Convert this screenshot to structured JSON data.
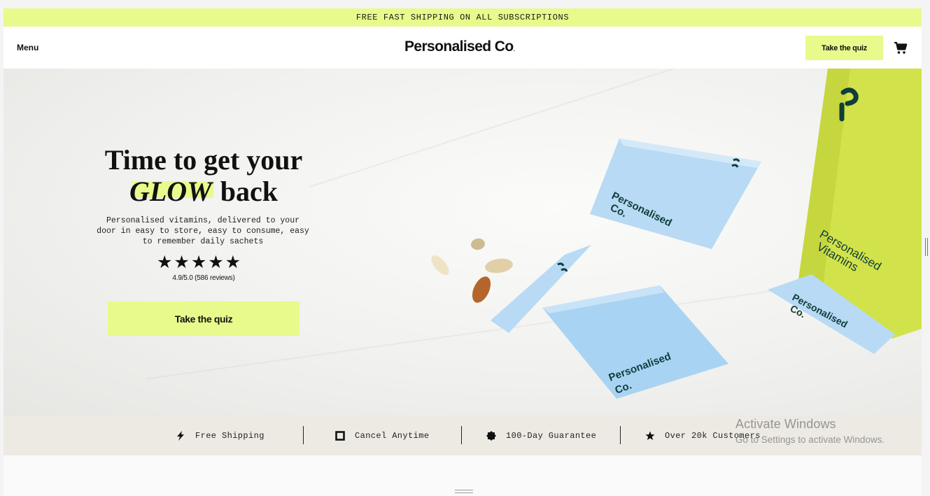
{
  "announcement": "FREE FAST SHIPPING ON ALL SUBSCRIPTIONS",
  "header": {
    "menu_label": "Menu",
    "logo": "Personalised Co",
    "logo_mark": ".",
    "quiz_label": "Take the quiz",
    "cart_icon": "cart-icon"
  },
  "hero": {
    "title_line1": "Time to get your",
    "title_highlight": "GLOW",
    "title_line2_rest": "back",
    "subtitle": "Personalised vitamins, delivered to your door in easy to store, easy to consume, easy to remember daily sachets",
    "stars": "★★★★★",
    "rating": "4.9/5.0 (586 reviews)",
    "cta_label": "Take the quiz",
    "product_text": {
      "sachet_brand_line1": "Personalised",
      "sachet_brand_line2": "Co.",
      "box_line1": "Personalised",
      "box_line2": "Vitamins"
    }
  },
  "trust_bar": [
    {
      "icon": "lightning-icon",
      "label": "Free Shipping"
    },
    {
      "icon": "square-icon",
      "label": "Cancel Anytime"
    },
    {
      "icon": "seal-icon",
      "label": "100-Day Guarantee"
    },
    {
      "icon": "star-icon",
      "label": "Over 20k Customers"
    }
  ],
  "watermark": {
    "title": "Activate Windows",
    "subtitle": "Go to Settings to activate Windows."
  },
  "colors": {
    "accent": "#e8fa8c",
    "sachet_blue": "#a9d3f2",
    "box_green": "#d2e24a",
    "brand_dark": "#0f3d3a",
    "trust_bg": "#eceae2"
  }
}
